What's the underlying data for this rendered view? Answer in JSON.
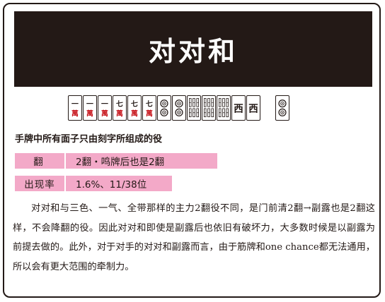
{
  "title": "对对和",
  "tiles": [
    {
      "suit": "wan",
      "rank": "一"
    },
    {
      "suit": "wan",
      "rank": "一"
    },
    {
      "suit": "wan",
      "rank": "一"
    },
    {
      "suit": "wan",
      "rank": "七"
    },
    {
      "suit": "wan",
      "rank": "七"
    },
    {
      "suit": "wan",
      "rank": "七"
    },
    {
      "suit": "pin",
      "rank": "2"
    },
    {
      "suit": "pin",
      "rank": "2"
    },
    {
      "suit": "sou",
      "rank": "8"
    },
    {
      "suit": "sou",
      "rank": "8"
    },
    {
      "suit": "sou",
      "rank": "8"
    },
    {
      "suit": "honor",
      "rank": "西"
    },
    {
      "suit": "honor",
      "rank": "西"
    },
    {
      "suit": "pin",
      "rank": "2"
    }
  ],
  "description": "手牌中所有面子只由刻字所组成的役",
  "fan": {
    "label": "翻",
    "value": "2翻・鸣牌后也是2翻"
  },
  "rate": {
    "label": "出现率",
    "value": "1.6%、11/38位"
  },
  "body": "对对和与三色、一气、全带那样的主力2翻役不同，是门前清2翻→副露也是2翻这样，不会降翻的役。因此对对和即使是副露后也依旧有破坏力，大多数时候是以副露为前提去做的。此外，对于对手的对对和副露而言，由于筋牌和one chance都无法通用，所以会有更大范围的牵制力。",
  "colors": {
    "dark": "#231916",
    "pink": "#f3a9c8",
    "wan_red": "#c8161d"
  }
}
